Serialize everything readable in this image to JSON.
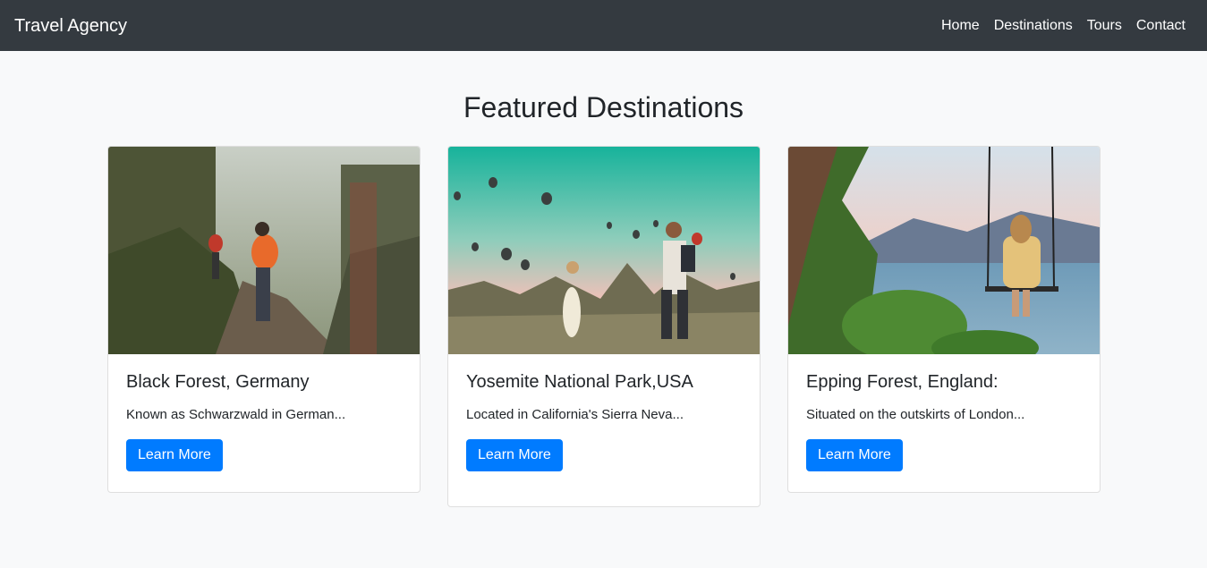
{
  "navbar": {
    "brand": "Travel Agency",
    "links": [
      "Home",
      "Destinations",
      "Tours",
      "Contact"
    ]
  },
  "page": {
    "title": "Featured Destinations"
  },
  "cards": [
    {
      "title": "Black Forest, Germany",
      "text": "Known as Schwarzwald in German...",
      "button": "Learn More",
      "image": "hikers-forest-trail-photo"
    },
    {
      "title": "Yosemite National Park,USA",
      "text": "Located in California's Sierra Neva...",
      "button": "Learn More",
      "image": "hot-air-balloons-photo"
    },
    {
      "title": "Epping Forest, England:",
      "text": "Situated on the outskirts of London...",
      "button": "Learn More",
      "image": "woman-on-swing-lake-photo"
    }
  ],
  "colors": {
    "navbar": "#343a40",
    "background": "#f8f9fa",
    "primary": "#007bff"
  }
}
